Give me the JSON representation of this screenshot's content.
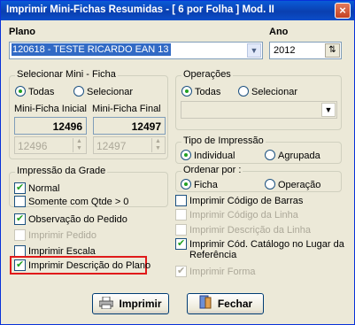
{
  "window": {
    "title": "Imprimir Mini-Fichas Resumidas - [ 6 por Folha ] Mod. II",
    "close_label": "×"
  },
  "plano": {
    "label": "Plano",
    "value": "120618 - TESTE RICARDO EAN 13"
  },
  "ano": {
    "label": "Ano",
    "value": "2012"
  },
  "selecionar_mini_ficha": {
    "legend": "Selecionar Mini - Ficha",
    "radio_todas": "Todas",
    "radio_selecionar": "Selecionar",
    "selected": "Todas",
    "inicial_label": "Mini-Ficha Inicial",
    "final_label": "Mini-Ficha Final",
    "inicial_value": "12496",
    "final_value": "12497",
    "inicial_spin_value": "12496",
    "final_spin_value": "12497"
  },
  "operacoes": {
    "legend": "Operações",
    "radio_todas": "Todas",
    "radio_selecionar": "Selecionar",
    "selected": "Todas",
    "select_value": ""
  },
  "tipo_impressao": {
    "legend": "Tipo de Impressão",
    "individual": "Individual",
    "agrupada": "Agrupada",
    "selected": "Individual"
  },
  "ordenar_por": {
    "legend": "Ordenar por :",
    "ficha": "Ficha",
    "operacao": "Operação",
    "selected": "Ficha"
  },
  "impressao_grade": {
    "legend": "Impressão da Grade",
    "normal": "Normal",
    "somente_com_qtde": "Somente com Qtde > 0"
  },
  "options_left": {
    "observacao_pedido": "Observação do Pedido",
    "imprimir_pedido": "Imprimir Pedido",
    "imprimir_escala": "Imprimir Escala",
    "imprimir_descricao_plano": "Imprimir Descrição do Plano"
  },
  "options_right": {
    "codigo_barras": "Imprimir Código de Barras",
    "codigo_linha": "Imprimir Código da Linha",
    "descricao_linha": "Imprimir Descrição da Linha",
    "cod_catalogo_line1": "Imprimir Cód. Catálogo no Lugar da",
    "cod_catalogo_line2": "Referência",
    "imprimir_forma": "Imprimir Forma"
  },
  "buttons": {
    "imprimir": "Imprimir",
    "fechar": "Fechar"
  },
  "colors": {
    "titlebar": "#0a5bd7",
    "selection": "#316ac5",
    "highlight_border": "#e01a1a",
    "check_green": "#21a121"
  }
}
